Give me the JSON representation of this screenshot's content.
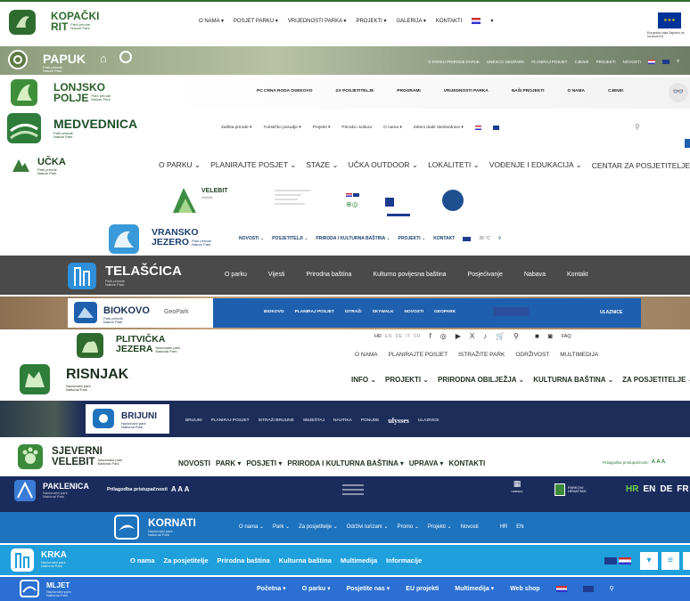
{
  "kopacki": {
    "name1": "KOPAČKI",
    "name2": "RIT",
    "sub": "Park prirode Nature Park",
    "nav": [
      "O NAMA ▾",
      "POSJET PARKU ▾",
      "VRIJEDNOSTI PARKA ▾",
      "PROJEKTI ▾",
      "GALERIJA ▾",
      "KONTAKTI"
    ],
    "eu": "Europska unija Zajedno do fondova EU"
  },
  "papuk": {
    "name": "PAPUK",
    "sub": "Park prirode Nature Park",
    "nav": [
      "O PARKU PRIRODE PAPUK",
      "UNESCO GEOPARK",
      "PLANIRAJ POSJET",
      "CJENIK",
      "PROJEKTI",
      "NOVOSTI"
    ]
  },
  "lonjsko": {
    "name1": "LONJSKO",
    "name2": "POLJE",
    "sub": "Park prirode Nature Park",
    "nav": [
      "PC CRNA RODA OSEKOVO",
      "ZA POSJETITELJE",
      "PROGRAMI",
      "VRIJEDNOSTI PARKA",
      "NAŠI PROJEKTI",
      "O NAMA",
      "CJENIK"
    ]
  },
  "medvednica": {
    "name": "MEDVEDNICA",
    "sub": "Park prirode Nature Park",
    "nav": [
      "Zaštita prirode ▾",
      "Turističko posudje ▾",
      "Projekti ▾",
      "Priroda i kultura",
      "O nama ▾",
      "Zeleni dodir Medvednice ▾"
    ]
  },
  "ucka": {
    "name": "UČKA",
    "sub": "Park prirode Nature Park",
    "nav": [
      "O PARKU ⌄",
      "PLANIRAJTE POSJET ⌄",
      "STAZE ⌄",
      "UČKA OUTDOOR ⌄",
      "LOKALITETI ⌄",
      "VOĐENJE I EDUKACIJA ⌄",
      "CENTAR ZA POSJETITELJE POKLON"
    ]
  },
  "velebit": {
    "name": "VELEBIT",
    "sub": "Velebit"
  },
  "vransko": {
    "name1": "VRANSKO",
    "name2": "JEZERO",
    "sub": "Park prirode Nature Park",
    "nav": [
      "NOVOSTI ⌄",
      "POSJETITELJI ⌄",
      "PRIRODA I KULTURNA BAŠTINA ⌄",
      "PROJEKTI ⌄",
      "KONTAKT"
    ],
    "temp": "36 °C"
  },
  "telascica": {
    "name": "TELAŠĆICA",
    "sub": "Park prirode Nature Park",
    "nav": [
      "O parku",
      "Vijesti",
      "Prirodna baština",
      "Kulturno povijesna baština",
      "Posjećivanje",
      "Nabava",
      "Kontakt"
    ]
  },
  "biokovo": {
    "name": "BIOKOVO",
    "sub": "Park prirode Nature Park",
    "geopark": "GeoPark",
    "nav": [
      "BIOKOVO",
      "PLANIRAJ POSJET",
      "ISTRAŽI",
      "SKYWALK",
      "NOVOSTI",
      "GEOPARK"
    ],
    "ulaznice": "ULAZNICE"
  },
  "plitvicka": {
    "name1": "PLITVIČKA",
    "name2": "JEZERA",
    "sub": "Nacionalni park National Park",
    "langs": [
      "HR",
      "EN",
      "DE",
      "IT",
      "FR"
    ],
    "faq": "FAQ",
    "nav": [
      "O NAMA",
      "PLANIRAJTE POSJET",
      "ISTRAŽITE PARK",
      "ODRŽIVOST",
      "MULTIMEDIJA"
    ]
  },
  "risnjak": {
    "name": "RISNJAK",
    "sub": "Nacionalni park National Park",
    "nav": [
      "INFO ⌄",
      "PROJEKTI ⌄",
      "PRIRODNA OBILJEŽJA ⌄",
      "KULTURNA BAŠTINA ⌄",
      "ZA POSJETITELJE ⌄"
    ]
  },
  "brijuni": {
    "name": "BRIJUNI",
    "sub": "Nacionalni park National Park",
    "nav": [
      "BRIJUNI",
      "PLANIRAJ POSJET",
      "ISTRAŽI BRIJUNE",
      "SMJEŠTAJ",
      "NAUTIKA",
      "PONUDE"
    ],
    "ulysses": "ulysses",
    "ulaznice": "ULAZNICE"
  },
  "sjeverni": {
    "name1": "SJEVERNI",
    "name2": "VELEBIT",
    "sub": "Nacionalni park National Park",
    "nav": [
      "NOVOSTI",
      "PARK ▾",
      "POSJETI ▾",
      "PRIRODA I KULTURNA BAŠTINA ▾",
      "UPRAVA ▾",
      "KONTAKTI"
    ],
    "access": "Prilagodba pristupačnosti:",
    "access_sizes": "A A A"
  },
  "paklenica": {
    "name": "PAKLENICA",
    "sub": "Nacionalni park National Park",
    "access": "Prilagodba pristupačnosti",
    "access_sizes": "A A A",
    "unesco": "unesco",
    "parkovi": "PARKOVI HRVATSKE",
    "langs": [
      "HR",
      "EN",
      "DE",
      "FR"
    ]
  },
  "kornati": {
    "name": "KORNATI",
    "sub": "Nacionalni park National Park",
    "nav": [
      "O nama ⌄",
      "Park ⌄",
      "Za posjetitelje ⌄",
      "Održivi turizam ⌄",
      "Promo ⌄",
      "Projekti ⌄",
      "Novosti"
    ],
    "langs": [
      "HR",
      "EN"
    ]
  },
  "krka": {
    "name": "KRKA",
    "sub": "Nacionalni park National Park",
    "nav": [
      "O nama",
      "Za posjetitelje",
      "Prirodna baština",
      "Kulturna baština",
      "Multimedija",
      "Informacije"
    ]
  },
  "mljet": {
    "name": "MLJET",
    "sub": "Nacionalni park National Park",
    "nav": [
      "Početna ▾",
      "O parku ▾",
      "Posjetite nas ▾",
      "EU projekti",
      "Multimedija ▾",
      "Web shop"
    ]
  },
  "colors": {
    "kopacki_green": "#2e6b2f",
    "papuk_bg": "#8d9c7a",
    "lonjsko_green": "#3f8f3a",
    "medvednica_green": "#2f7d3b",
    "ucka_green": "#3a7a3a",
    "telascica_bg": "#4a4a4a",
    "biokovo_blue": "#1e5fae",
    "plitvicka_green": "#2f6a2f",
    "risnjak_green": "#2e7d3b",
    "brijuni_navy": "#1c2d5a",
    "paklenica_navy": "#1a2c5c",
    "kornati_blue": "#1e73be",
    "krka_blue": "#1fa0dc",
    "mljet_blue": "#2a6fd1"
  }
}
